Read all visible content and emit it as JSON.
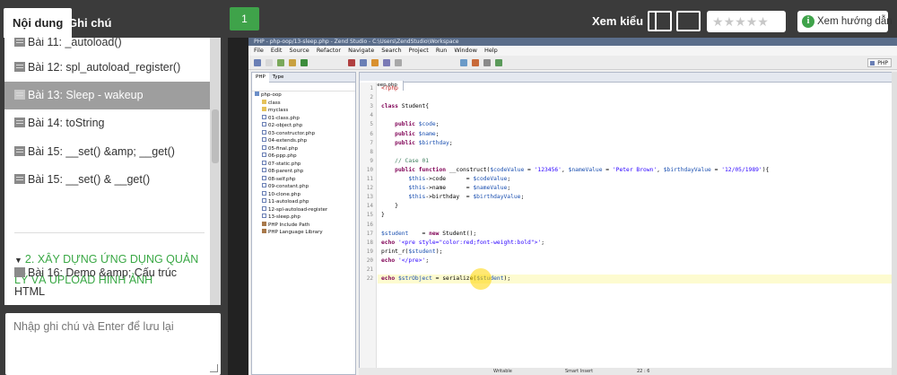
{
  "tabs": {
    "content": "Nội dung",
    "notes": "Ghi chú"
  },
  "lessons": {
    "l11": "Bài 11: _autoload()",
    "l12": "Bài 12: spl_autoload_register()",
    "l13": "Bài 13: Sleep - wakeup",
    "l14": "Bài 14: toString",
    "l15a": "Bài 15: __set() &amp; __get()",
    "l15b": "Bài 15: __set() & __get()",
    "section2": "2. XÂY DỰNG ỨNG DỤNG QUẢN LÝ VÀ UPLOAD HÌNH ẢNH",
    "l16": "Bài 16: Demo &amp; Cấu trúc HTML"
  },
  "note": {
    "placeholder": "Nhập ghi chú và Enter để lưu lại"
  },
  "header": {
    "part": "1",
    "view_label": "Xem kiểu",
    "rating_stars": 0,
    "guide_label": "Xem hướng dẫn"
  },
  "ide": {
    "title": "PHP - php-oop/13-sleep.php - Zend Studio - C:\\Users\\ZendStudio\\Workspace",
    "menu": [
      "File",
      "Edit",
      "Source",
      "Refactor",
      "Navigate",
      "Search",
      "Project",
      "Run",
      "Window",
      "Help"
    ],
    "perspective": "PHP",
    "explorer_tabs": [
      "PHP",
      "Type"
    ],
    "tree": [
      {
        "name": "php-oop",
        "icon": "project",
        "depth": 0
      },
      {
        "name": "class",
        "icon": "folder",
        "depth": 1
      },
      {
        "name": "myclass",
        "icon": "folder",
        "depth": 1
      },
      {
        "name": "01-class.php",
        "icon": "php",
        "depth": 1
      },
      {
        "name": "02-object.php",
        "icon": "php",
        "depth": 1
      },
      {
        "name": "03-constructor.php",
        "icon": "php",
        "depth": 1
      },
      {
        "name": "04-extends.php",
        "icon": "php",
        "depth": 1
      },
      {
        "name": "05-final.php",
        "icon": "php",
        "depth": 1
      },
      {
        "name": "06-ppp.php",
        "icon": "php",
        "depth": 1
      },
      {
        "name": "07-static.php",
        "icon": "php",
        "depth": 1
      },
      {
        "name": "08-parent.php",
        "icon": "php",
        "depth": 1
      },
      {
        "name": "08-self.php",
        "icon": "php",
        "depth": 1
      },
      {
        "name": "09-constant.php",
        "icon": "php",
        "depth": 1
      },
      {
        "name": "10-clone.php",
        "icon": "php",
        "depth": 1
      },
      {
        "name": "11-autoload.php",
        "icon": "php",
        "depth": 1
      },
      {
        "name": "12-spl-autoload-register",
        "icon": "php",
        "depth": 1
      },
      {
        "name": "13-sleep.php",
        "icon": "php",
        "depth": 1
      },
      {
        "name": "PHP Include Path",
        "icon": "lib",
        "depth": 1
      },
      {
        "name": "PHP Language Library",
        "icon": "lib",
        "depth": 1
      }
    ],
    "editor_tab": "13-sleep.php",
    "line_numbers": [
      "1",
      "2",
      "3",
      "4",
      "5",
      "6",
      "7",
      "8",
      "9",
      "10",
      "11",
      "12",
      "13",
      "14",
      "15",
      "16",
      "17",
      "18",
      "19",
      "20",
      "21",
      "22"
    ],
    "current_line": "22",
    "status": {
      "mode": "Writable",
      "insert": "Smart Insert",
      "pos": "22 : 6"
    }
  },
  "code_lines": [
    [
      [
        "tag",
        "<?php"
      ]
    ],
    [],
    [
      [
        "kw",
        "class"
      ],
      [
        "",
        " Student{"
      ]
    ],
    [],
    [
      [
        "",
        "    "
      ],
      [
        "kw",
        "public"
      ],
      [
        "",
        " "
      ],
      [
        "var",
        "$code"
      ],
      [
        "",
        ";"
      ]
    ],
    [
      [
        "",
        "    "
      ],
      [
        "kw",
        "public"
      ],
      [
        "",
        " "
      ],
      [
        "var",
        "$name"
      ],
      [
        "",
        ";"
      ]
    ],
    [
      [
        "",
        "    "
      ],
      [
        "kw",
        "public"
      ],
      [
        "",
        " "
      ],
      [
        "var",
        "$birthday"
      ],
      [
        "",
        ";"
      ]
    ],
    [],
    [
      [
        "cmt",
        "    // Case 01"
      ]
    ],
    [
      [
        "",
        "    "
      ],
      [
        "kw",
        "public function"
      ],
      [
        "",
        " __construct("
      ],
      [
        "var",
        "$codeValue"
      ],
      [
        "",
        " = "
      ],
      [
        "str",
        "'123456'"
      ],
      [
        "",
        ", "
      ],
      [
        "var",
        "$nameValue"
      ],
      [
        "",
        " = "
      ],
      [
        "str",
        "'Peter Brown'"
      ],
      [
        "",
        ", "
      ],
      [
        "var",
        "$birthdayValue"
      ],
      [
        "",
        " = "
      ],
      [
        "str",
        "'12/05/1989'"
      ],
      [
        "",
        "){"
      ]
    ],
    [
      [
        "",
        "        "
      ],
      [
        "var",
        "$this"
      ],
      [
        "",
        "->code      = "
      ],
      [
        "var",
        "$codeValue"
      ],
      [
        "",
        ";"
      ]
    ],
    [
      [
        "",
        "        "
      ],
      [
        "var",
        "$this"
      ],
      [
        "",
        "->name      = "
      ],
      [
        "var",
        "$nameValue"
      ],
      [
        "",
        ";"
      ]
    ],
    [
      [
        "",
        "        "
      ],
      [
        "var",
        "$this"
      ],
      [
        "",
        "->birthday  = "
      ],
      [
        "var",
        "$birthdayValue"
      ],
      [
        "",
        ";"
      ]
    ],
    [
      [
        "",
        "    }"
      ]
    ],
    [
      [
        "",
        "}"
      ]
    ],
    [],
    [
      [
        "var",
        "$student"
      ],
      [
        "",
        "    = "
      ],
      [
        "kw",
        "new"
      ],
      [
        "",
        " Student();"
      ]
    ],
    [
      [
        "kw",
        "echo"
      ],
      [
        "",
        " "
      ],
      [
        "str",
        "'<pre style=\"color:red;font-weight:bold\">'"
      ],
      [
        "",
        ";"
      ]
    ],
    [
      [
        "",
        "print_r("
      ],
      [
        "var",
        "$student"
      ],
      [
        "",
        ");"
      ]
    ],
    [
      [
        "kw",
        "echo"
      ],
      [
        "",
        " "
      ],
      [
        "str",
        "'</pre>'"
      ],
      [
        "",
        ";"
      ]
    ],
    [],
    [
      [
        "kw",
        "echo"
      ],
      [
        "",
        " "
      ],
      [
        "var",
        "$strObject"
      ],
      [
        "",
        " = serialize("
      ],
      [
        "var",
        "$student"
      ],
      [
        "",
        ");"
      ]
    ]
  ],
  "colors": {
    "accent_green": "#3fa34a",
    "active_item": "#9e9e9e",
    "page_bg": "#3b3b3b"
  }
}
